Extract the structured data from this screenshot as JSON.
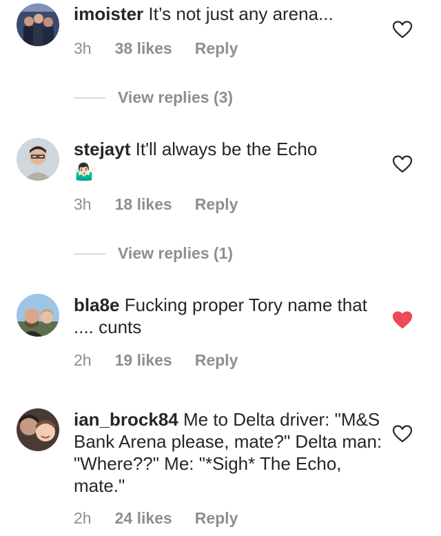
{
  "colors": {
    "text": "#262626",
    "muted": "#8e8e8e",
    "liked_heart": "#ed4956"
  },
  "comments": [
    {
      "username": "imoister",
      "text": "It’s not just any arena...",
      "time": "3h",
      "likes": "38 likes",
      "reply": "Reply",
      "liked": false,
      "view_replies": "View replies (3)"
    },
    {
      "username": "stejayt",
      "text": "It'll always be the Echo",
      "emoji": "🤷🏻‍♂️",
      "time": "3h",
      "likes": "18 likes",
      "reply": "Reply",
      "liked": false,
      "view_replies": "View replies (1)"
    },
    {
      "username": "bla8e",
      "text": "Fucking proper Tory name that .... cunts",
      "time": "2h",
      "likes": "19 likes",
      "reply": "Reply",
      "liked": true
    },
    {
      "username": "ian_brock84",
      "text": "Me to Delta driver: \"M&S Bank Arena please, mate?\" Delta man: \"Where??\" Me: \"*Sigh* The Echo, mate.\"",
      "time": "2h",
      "likes": "24 likes",
      "reply": "Reply",
      "liked": false
    }
  ]
}
